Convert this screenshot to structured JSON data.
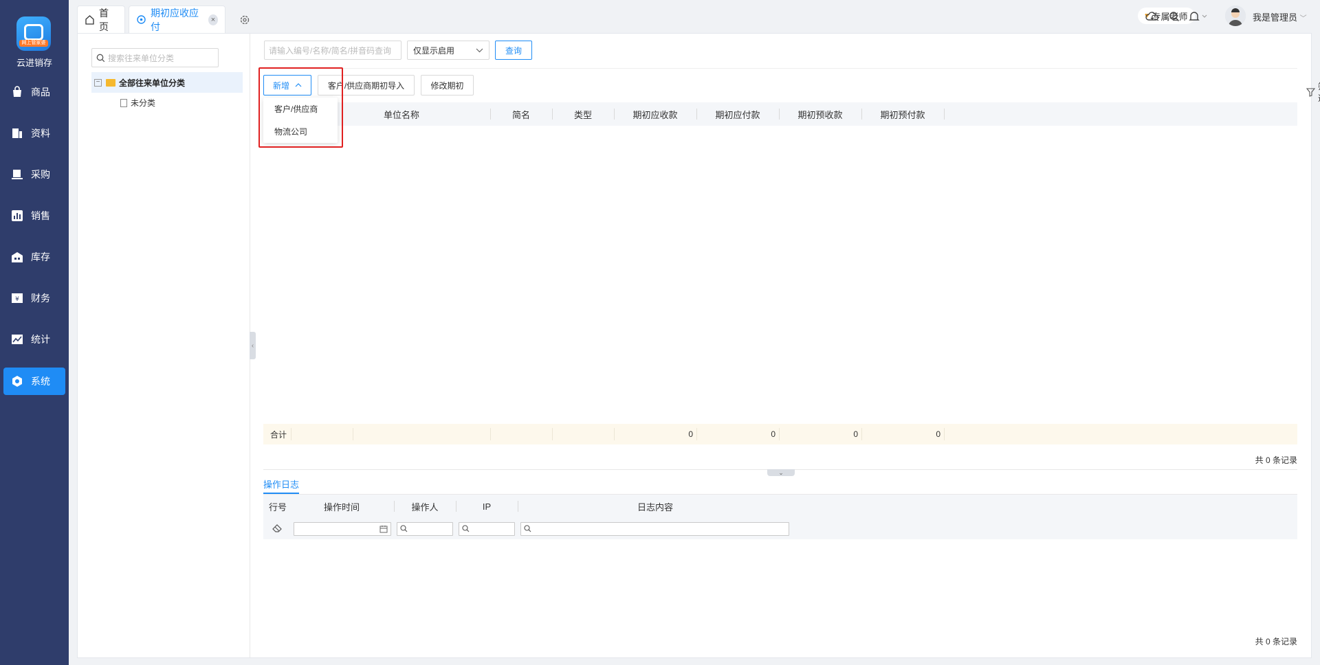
{
  "app": {
    "brand": "云进销存",
    "logo_tag": "网上管家婆"
  },
  "nav": [
    {
      "label": "商品",
      "icon": "bag-icon"
    },
    {
      "label": "资料",
      "icon": "document-icon"
    },
    {
      "label": "采购",
      "icon": "purchase-icon"
    },
    {
      "label": "销售",
      "icon": "chart-bar-icon"
    },
    {
      "label": "库存",
      "icon": "warehouse-icon"
    },
    {
      "label": "财务",
      "icon": "finance-icon"
    },
    {
      "label": "统计",
      "icon": "statistics-icon"
    },
    {
      "label": "系统",
      "icon": "system-icon",
      "active": true
    }
  ],
  "tabs": [
    {
      "label": "首页"
    },
    {
      "label": "期初应收应付",
      "active": true,
      "close": "×"
    }
  ],
  "header": {
    "teacher": "专属老师",
    "admin_name": "我是管理员"
  },
  "tree": {
    "search_placeholder": "搜索往来单位分类",
    "root": "全部往来单位分类",
    "child": "未分类"
  },
  "query": {
    "input_placeholder": "请输入编号/名称/简名/拼音码查询",
    "select_value": "仅显示启用",
    "button": "查询"
  },
  "toolbar": {
    "add": "新增",
    "import": "客户/供应商期初导入",
    "modify": "修改期初",
    "filter": "筛选",
    "export": "导出"
  },
  "dropdown": {
    "items": [
      "客户/供应商",
      "物流公司"
    ]
  },
  "grid": {
    "columns": [
      "单位名称",
      "简名",
      "类型",
      "期初应收款",
      "期初应付款",
      "期初预收款",
      "期初预付款"
    ],
    "sum_label": "合计",
    "sums": [
      "0",
      "0",
      "0",
      "0"
    ],
    "record_count": "共 0 条记录"
  },
  "log": {
    "tab": "操作日志",
    "columns": [
      "行号",
      "操作时间",
      "操作人",
      "IP",
      "日志内容"
    ],
    "record_count": "共 0 条记录"
  },
  "colors": {
    "nav_bg": "#2f3d6b",
    "accent": "#1f8cf5",
    "highlight_border": "#e02020"
  }
}
